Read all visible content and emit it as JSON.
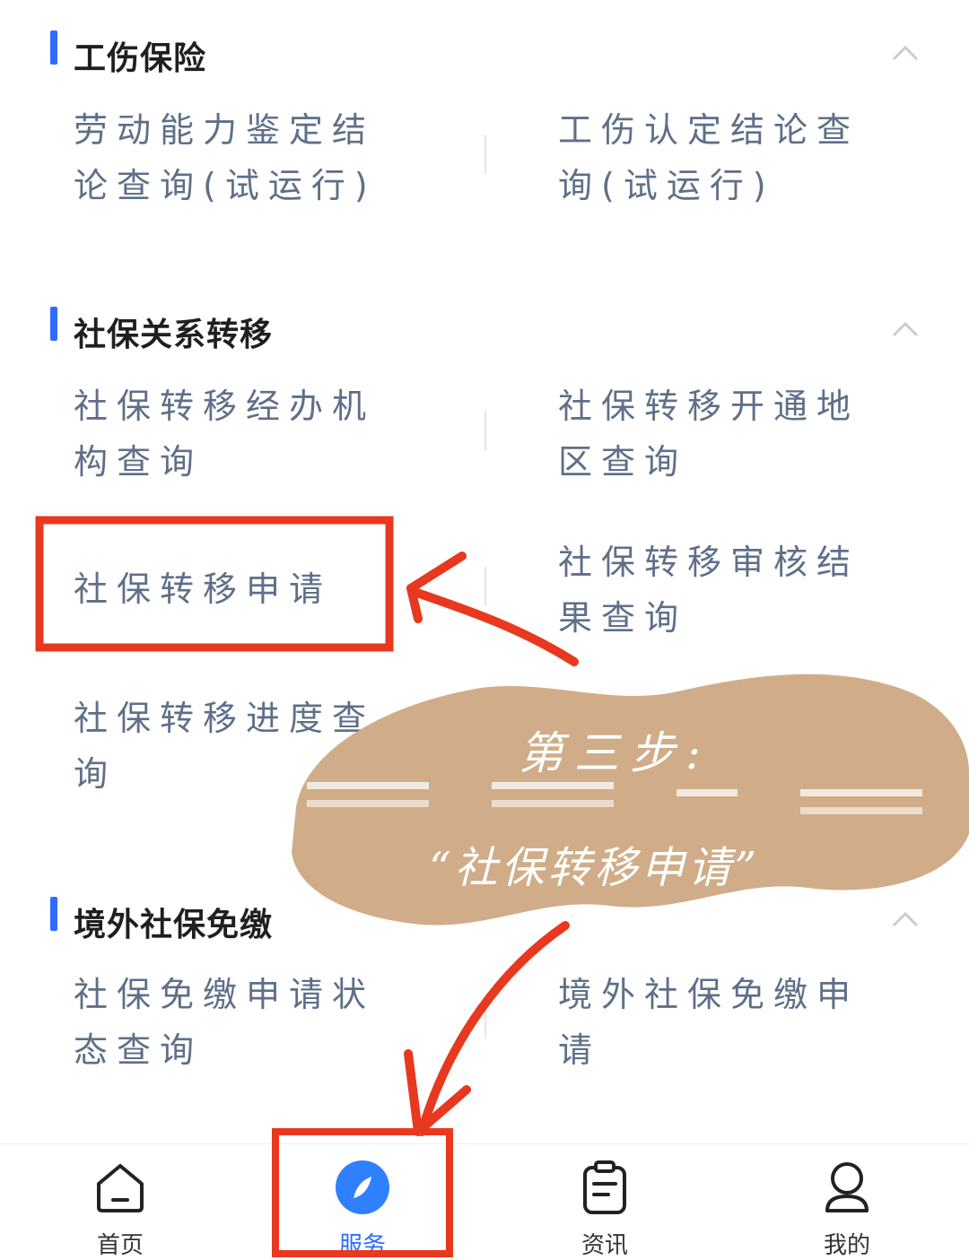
{
  "sections": [
    {
      "title": "工伤保险",
      "items": [
        {
          "label": "劳动能力鉴定结论查询(试运行)"
        },
        {
          "label": "工伤认定结论查询(试运行)"
        }
      ]
    },
    {
      "title": "社保关系转移",
      "items": [
        {
          "label": "社保转移经办机构查询"
        },
        {
          "label": "社保转移开通地区查询"
        },
        {
          "label": "社保转移申请"
        },
        {
          "label": "社保转移审核结果查询"
        },
        {
          "label": "社保转移进度查询"
        }
      ]
    },
    {
      "title": "境外社保免缴",
      "items": [
        {
          "label": "社保免缴申请状态查询"
        },
        {
          "label": "境外社保免缴申请"
        }
      ]
    }
  ],
  "annotation": {
    "step": "第三步:",
    "instruction": "“社保转移申请”"
  },
  "bottom_nav": [
    {
      "label": "首页",
      "icon": "home-icon"
    },
    {
      "label": "服务",
      "icon": "compass-icon",
      "active": true
    },
    {
      "label": "资讯",
      "icon": "clipboard-icon"
    },
    {
      "label": "我的",
      "icon": "user-icon"
    }
  ],
  "colors": {
    "accent": "#2f6bff",
    "item_text": "#5f6f89",
    "highlight": "#e8381f",
    "blob": "#d0ad88"
  }
}
